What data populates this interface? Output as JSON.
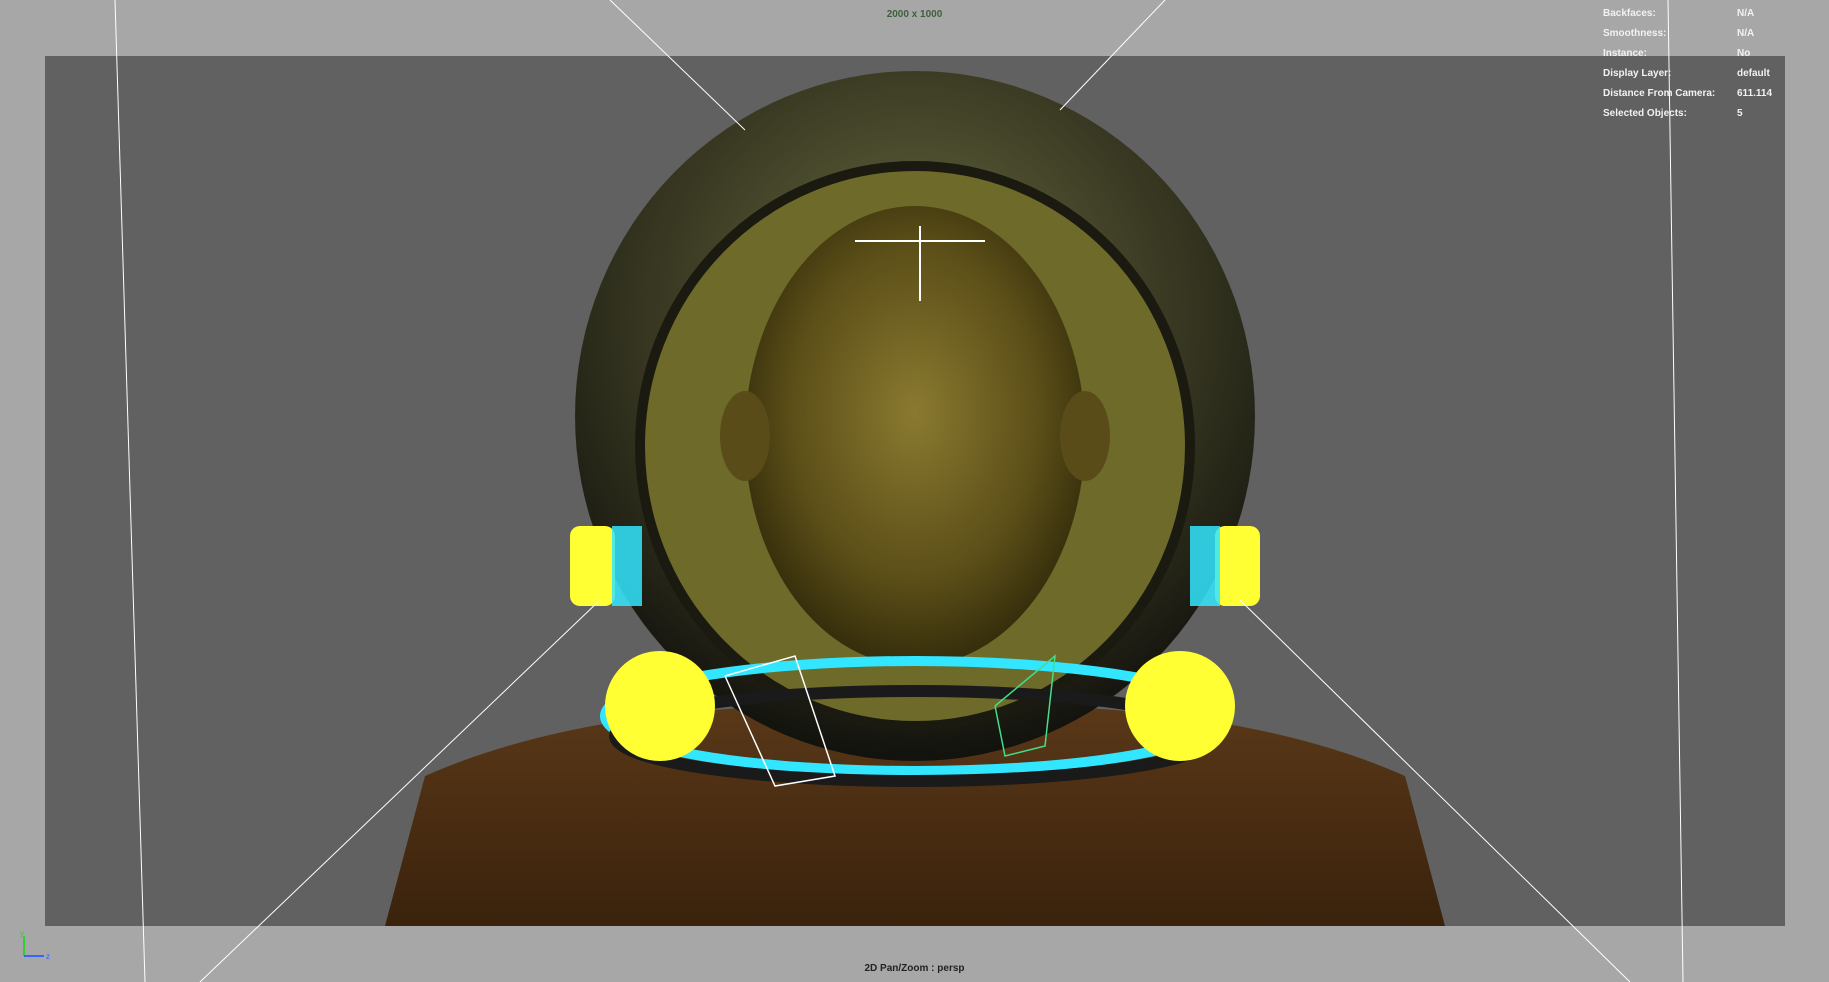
{
  "viewport": {
    "resolution_label": "2000 x 1000",
    "camera_label": "2D Pan/Zoom : persp"
  },
  "hud": [
    {
      "key": "Backfaces:",
      "value": "N/A"
    },
    {
      "key": "Smoothness:",
      "value": "N/A"
    },
    {
      "key": "Instance:",
      "value": "No"
    },
    {
      "key": "Display Layer:",
      "value": "default"
    },
    {
      "key": "Distance From Camera:",
      "value": "611.114"
    },
    {
      "key": "Selected Objects:",
      "value": "5"
    }
  ],
  "axis": {
    "y_label": "y",
    "z_label": "z"
  },
  "colors": {
    "background": "#a7a7a7",
    "gate": "#616161",
    "helmet_accent": "#ffff33",
    "ring_accent": "#33e6ff",
    "sweater": "#4a2e14"
  },
  "icons": {
    "axis": "axis-gizmo-icon"
  }
}
